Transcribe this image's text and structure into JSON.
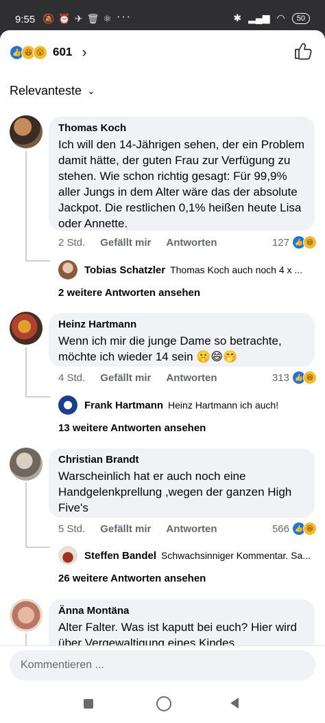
{
  "statusbar": {
    "time": "9:55",
    "left_icons": "🔕⏰✈🗑⚛",
    "dots": "···",
    "battery": "50"
  },
  "header": {
    "reaction_count": "601",
    "sort_label": "Relevanteste"
  },
  "comments": [
    {
      "name": "Thomas Koch",
      "text": "Ich will den 14-Jährigen sehen, der ein Problem damit hätte, der guten Frau zur Verfügung zu stehen. Wie schon richtig gesagt: Für 99,9% aller Jungs in dem Alter wäre das der absolute Jackpot. Die restlichen 0,1% heißen heute Lisa oder Annette.",
      "time": "2 Std.",
      "like_label": "Gefällt mir",
      "reply_label": "Antworten",
      "reactions": "127",
      "reply_name": "Tobias Schatzler",
      "reply_text": "Thomas Koch  auch noch 4 x ...",
      "more_replies": "2 weitere Antworten ansehen"
    },
    {
      "name": "Heinz Hartmann",
      "text": "Wenn ich mir die junge Dame so betrachte, möchte ich wieder 14 sein 🤫😄🤭",
      "time": "4 Std.",
      "like_label": "Gefällt mir",
      "reply_label": "Antworten",
      "reactions": "313",
      "reply_name": "Frank Hartmann",
      "reply_text": "Heinz Hartmann ich auch!",
      "more_replies": "13 weitere Antworten ansehen"
    },
    {
      "name": "Christian Brandt",
      "text": "Warscheinlich hat er auch noch eine Handgelenkprellung ,wegen der ganzen High Five's",
      "time": "5 Std.",
      "like_label": "Gefällt mir",
      "reply_label": "Antworten",
      "reactions": "566",
      "reply_name": "Steffen Bandel",
      "reply_text": "Schwachsinniger Kommentar. Sa...",
      "more_replies": "26 weitere Antworten ansehen"
    },
    {
      "name": "Änna Montäna",
      "text": "Alter Falter. Was ist kaputt bei euch? Hier wird über Vergewaltigung eines Kindes"
    }
  ],
  "input": {
    "placeholder": "Kommentieren ..."
  },
  "colors": {
    "accent_like": "#1b74e4",
    "bubble_bg": "#f0f2f5",
    "meta_text": "#65676b"
  }
}
